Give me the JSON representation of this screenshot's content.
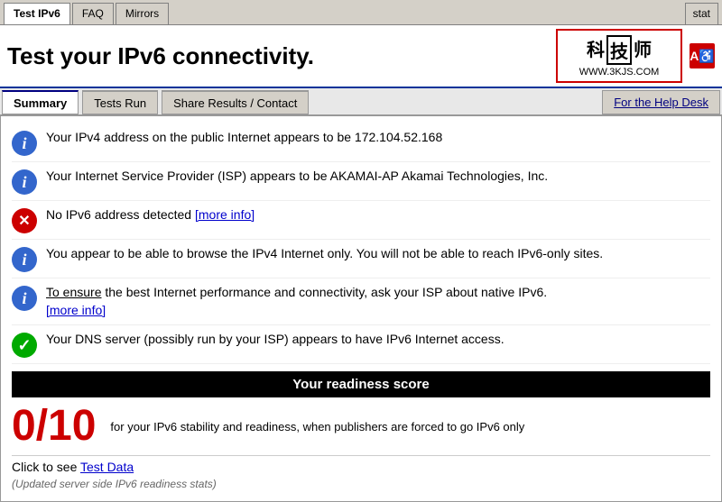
{
  "tabs": {
    "items": [
      {
        "id": "test-ipv6",
        "label": "Test IPv6",
        "active": true
      },
      {
        "id": "faq",
        "label": "FAQ",
        "active": false
      },
      {
        "id": "mirrors",
        "label": "Mirrors",
        "active": false
      }
    ],
    "stat_label": "stat"
  },
  "header": {
    "title": "Test your IPv6 connectivity.",
    "logo": {
      "chars": "科技师",
      "url": "WWW.3KJS.COM"
    },
    "accessibility_icon": "A"
  },
  "sub_nav": {
    "tabs": [
      {
        "id": "summary",
        "label": "Summary",
        "active": true
      },
      {
        "id": "tests-run",
        "label": "Tests Run",
        "active": false
      },
      {
        "id": "share-results",
        "label": "Share Results / Contact",
        "active": false
      }
    ],
    "help_desk": "For the Help Desk"
  },
  "results": [
    {
      "type": "info",
      "text": "Your IPv4 address on the public Internet appears to be 172.104.52.168"
    },
    {
      "type": "info",
      "text": "Your Internet Service Provider (ISP) appears to be AKAMAI-AP Akamai Technologies, Inc."
    },
    {
      "type": "error",
      "text": "No IPv6 address detected",
      "link": "[more info]"
    },
    {
      "type": "info",
      "text": "You appear to be able to browse the IPv4 Internet only. You will not be able to reach IPv6-only sites."
    },
    {
      "type": "info",
      "text_before": "To ensure",
      "text_after": " the best Internet performance and connectivity, ask your ISP about native IPv6.",
      "underline": "To ensure",
      "link": "[more info]",
      "has_underline": true
    },
    {
      "type": "success",
      "text": "Your DNS server (possibly run by your ISP) appears to have IPv6 Internet access."
    }
  ],
  "score": {
    "bar_label": "Your readiness score",
    "number": "0/10",
    "description": "for your IPv6 stability and readiness, when publishers are forced to go IPv6 only"
  },
  "bottom": {
    "click_to_see": "Click to see",
    "test_data_link": "Test Data",
    "updated_text": "(Updated server side IPv6 readiness stats)"
  }
}
